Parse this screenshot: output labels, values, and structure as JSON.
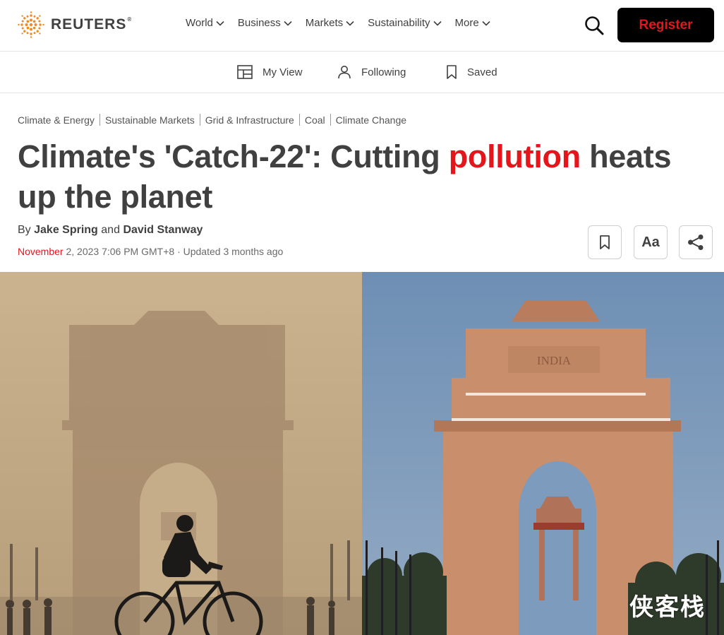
{
  "brand": {
    "name": "REUTERS",
    "registered_mark": "®",
    "accent_color": "#e4161b"
  },
  "nav": {
    "items": [
      {
        "label": "World",
        "has_chevron": true
      },
      {
        "label": "Business",
        "has_chevron": true
      },
      {
        "label": "Markets",
        "has_chevron": true
      },
      {
        "label": "Sustainability",
        "has_chevron": true
      },
      {
        "label": "More",
        "has_chevron": true
      }
    ],
    "search_icon": "search-icon",
    "register_label": "Register"
  },
  "subnav": {
    "items": [
      {
        "label": "My View",
        "icon": "layout-icon"
      },
      {
        "label": "Following",
        "icon": "person-icon"
      },
      {
        "label": "Saved",
        "icon": "bookmark-icon"
      }
    ]
  },
  "article": {
    "breadcrumbs": [
      "Climate & Energy",
      "Sustainable Markets",
      "Grid & Infrastructure",
      "Coal",
      "Climate Change"
    ],
    "headline": {
      "before": "Climate's 'Catch-22': Cutting ",
      "highlight": "pollution",
      "after": " heats up the planet"
    },
    "byline": {
      "prefix": "By",
      "author1": "Jake Spring",
      "conjunction": "and",
      "author2": "David Stanway"
    },
    "dateline": {
      "month": "November",
      "rest": " 2, 2023 7:06 PM GMT+8 · Updated 3 months ago"
    },
    "tools": {
      "bookmark_icon": "bookmark-icon",
      "text_size_label": "Aa",
      "share_icon": "share-icon"
    },
    "image": {
      "left_label": "INDIA"
    }
  },
  "watermark": "侠客栈"
}
